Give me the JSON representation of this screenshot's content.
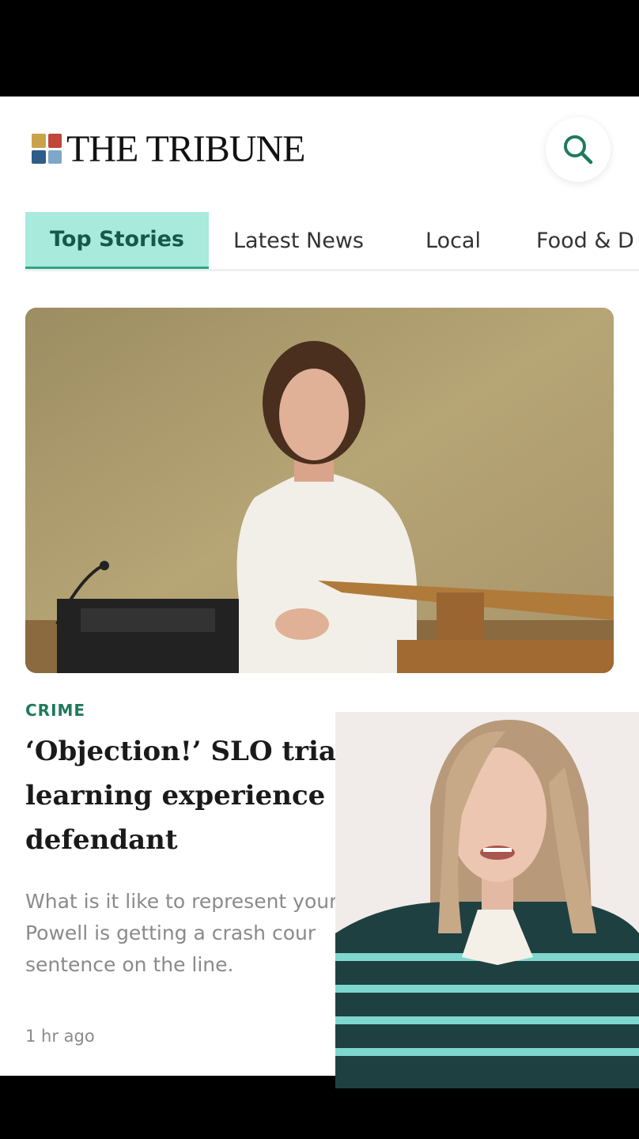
{
  "header": {
    "logo_text": "THE TRIBUNE",
    "search_icon": "search-icon"
  },
  "tabs": [
    {
      "label": "Top Stories",
      "active": true
    },
    {
      "label": "Latest News",
      "active": false
    },
    {
      "label": "Local",
      "active": false
    },
    {
      "label": "Food & D",
      "active": false
    }
  ],
  "article": {
    "category": "CRIME",
    "headline_lines": [
      "‘Objection!’ SLO trial is a diffic",
      "learning experience for elect",
      "defendant"
    ],
    "summary_lines": [
      "What is it like to represent yourself",
      "Powell is getting a crash cour",
      "sentence on the line."
    ],
    "timestamp": "1 hr ago"
  },
  "colors": {
    "accent": "#1f7a5c",
    "tab_active_bg": "#a8eadb",
    "tab_active_underline": "#2aa68a"
  }
}
